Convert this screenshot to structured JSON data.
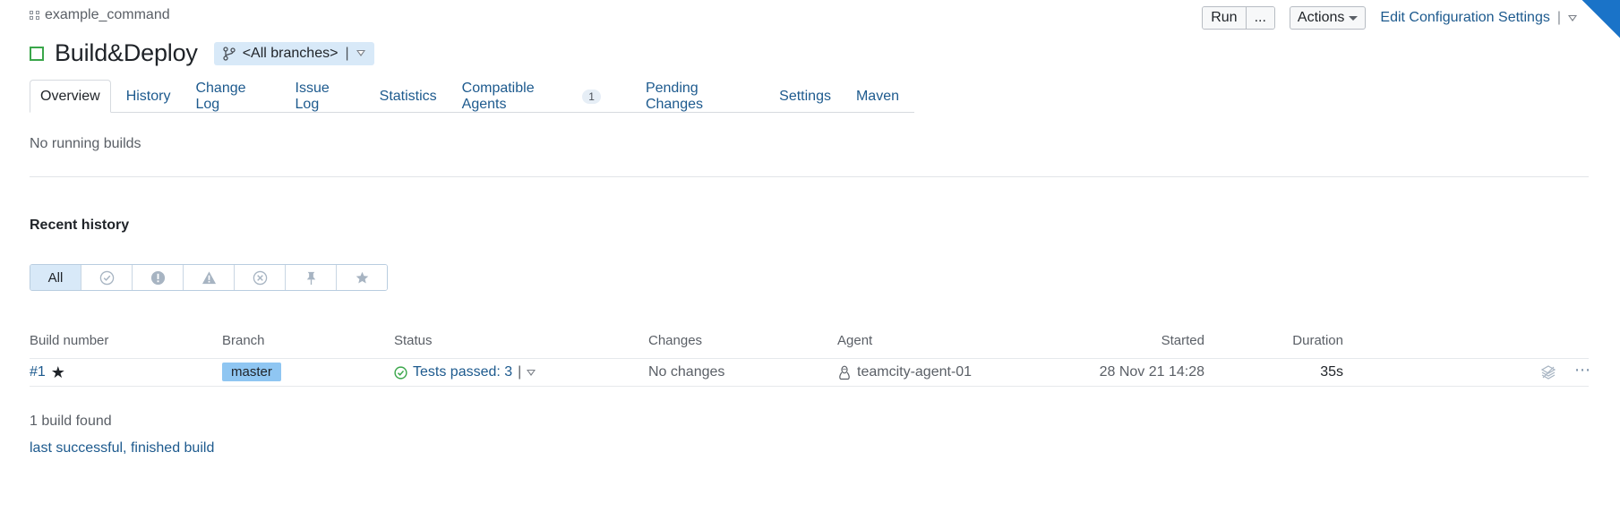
{
  "breadcrumb": {
    "project": "example_command"
  },
  "top_actions": {
    "run_label": "Run",
    "run_more_label": "...",
    "actions_label": "Actions",
    "edit_settings_label": "Edit Configuration Settings",
    "separator": "|"
  },
  "title": {
    "text": "Build&Deploy",
    "branch_selector": "<All branches>",
    "branch_separator": "|"
  },
  "tabs": [
    {
      "label": "Overview"
    },
    {
      "label": "History"
    },
    {
      "label": "Change Log"
    },
    {
      "label": "Issue Log"
    },
    {
      "label": "Statistics"
    },
    {
      "label": "Compatible Agents",
      "count": "1"
    },
    {
      "label": "Pending Changes"
    },
    {
      "label": "Settings"
    },
    {
      "label": "Maven"
    }
  ],
  "running": {
    "text": "No running builds"
  },
  "history": {
    "title": "Recent history",
    "filters": {
      "all_label": "All"
    },
    "columns": {
      "build_number": "Build number",
      "branch": "Branch",
      "status": "Status",
      "changes": "Changes",
      "agent": "Agent",
      "started": "Started",
      "duration": "Duration"
    },
    "rows": [
      {
        "number": "#1",
        "branch": "master",
        "status": "Tests passed: 3",
        "status_separator": "|",
        "changes": "No changes",
        "agent": "teamcity-agent-01",
        "started": "28 Nov 21 14:28",
        "duration": "35s",
        "more": "⋯"
      }
    ],
    "found_text": "1 build found",
    "links": {
      "last_successful": "last successful",
      "separator": ", ",
      "finished": "finished build"
    }
  },
  "colors": {
    "accent": "#1d5a8e",
    "success": "#3aa64a",
    "branch_badge": "#8fc6f2",
    "selected_filter": "#d8e9f8"
  }
}
